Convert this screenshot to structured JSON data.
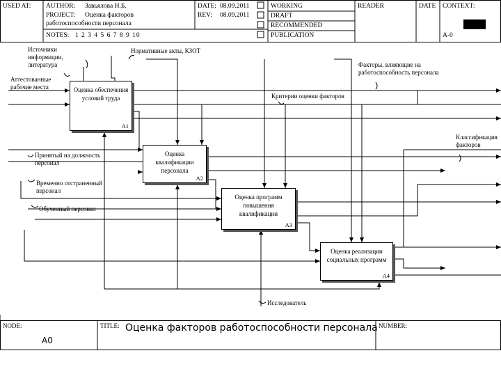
{
  "header": {
    "used_at": "USED AT:",
    "author_label": "AUTHOR:",
    "author": "Завьялова Н.Б.",
    "project_label": "PROJECT:",
    "project_line1": "Оценка факторов",
    "project_line2": "работоспособности персонала",
    "date_label": "DATE:",
    "date": "08.09.2011",
    "rev_label": "REV:",
    "rev": "08.09.2011",
    "notes_label": "NOTES:",
    "notes": "1 2 3 4 5 6 7 8 9 10",
    "status": [
      "WORKING",
      "DRAFT",
      "RECOMMENDED",
      "PUBLICATION"
    ],
    "reader": "READER",
    "date2": "DATE",
    "context": "CONTEXT:",
    "node_ref": "A-0"
  },
  "boxes": [
    {
      "title": "Оценка обеспечения условий труда",
      "num": "A1"
    },
    {
      "title": "Оценка квалификации персонала",
      "num": "A2"
    },
    {
      "title": "Оценка программ повышения квалификации",
      "num": "A3"
    },
    {
      "title": "Оценка реализации социальных программ",
      "num": "A4"
    }
  ],
  "labels": {
    "sources": "Источники информации, литература",
    "normative": "Нормативные акты, КЗОТ",
    "workplaces": "Аттестованные рабочие места",
    "factors": "Факторы, влияющие на работоспособность персонала",
    "criteria": "Критерии оценки факторов",
    "classification": "Классификация факторов",
    "hired": "Принятый на должность персонал",
    "suspended": "Временно отстраненный персонал",
    "trained": "Обученный персонал",
    "researcher": "Исследователь"
  },
  "footer": {
    "node_label": "NODE:",
    "node": "A0",
    "title_label": "TITLE:",
    "title": "Оценка факторов работоспособности персонала",
    "number_label": "NUMBER:"
  }
}
